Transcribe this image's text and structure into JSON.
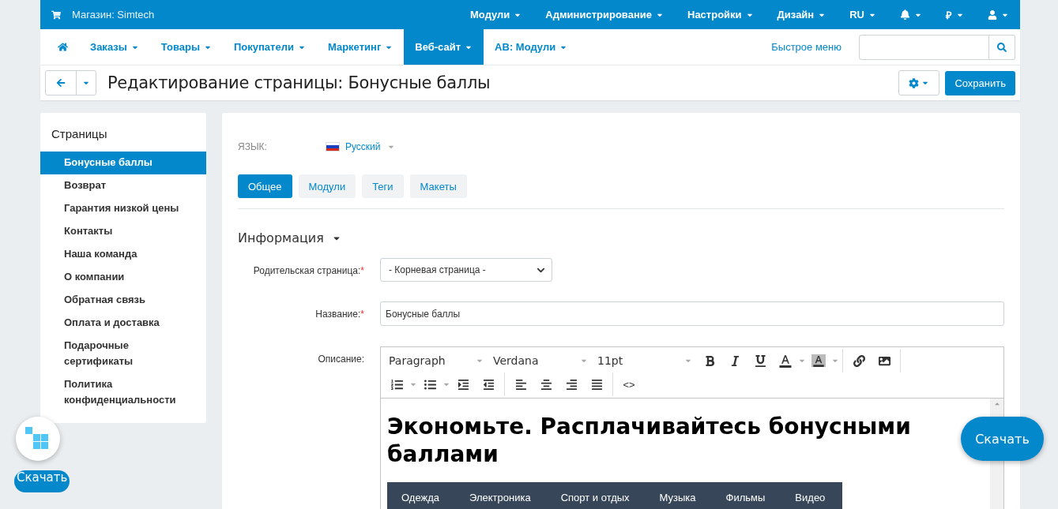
{
  "top_bar": {
    "store": "Магазин: Simtech",
    "menus": [
      "Модули",
      "Администрирование",
      "Настройки",
      "Дизайн",
      "RU"
    ],
    "currency": "₽"
  },
  "nav": {
    "items": [
      {
        "label": "Заказы",
        "selected": false
      },
      {
        "label": "Товары",
        "selected": false
      },
      {
        "label": "Покупатели",
        "selected": false
      },
      {
        "label": "Маркетинг",
        "selected": false
      },
      {
        "label": "Веб-сайт",
        "selected": true
      },
      {
        "label": "AB: Модули",
        "selected": false
      }
    ],
    "quick_menu": "Быстрое меню"
  },
  "title_bar": {
    "title": "Редактирование страницы: Бонусные баллы",
    "save": "Сохранить"
  },
  "sidebar": {
    "title": "Страницы",
    "items": [
      {
        "label": "Бонусные баллы",
        "selected": true
      },
      {
        "label": "Возврат",
        "selected": false
      },
      {
        "label": "Гарантия низкой цены",
        "selected": false
      },
      {
        "label": "Контакты",
        "selected": false
      },
      {
        "label": "Наша команда",
        "selected": false
      },
      {
        "label": "О компании",
        "selected": false
      },
      {
        "label": "Обратная связь",
        "selected": false
      },
      {
        "label": "Оплата и доставка",
        "selected": false
      },
      {
        "label": "Подарочные сертификаты",
        "selected": false
      },
      {
        "label": "Политика конфиденциальности",
        "selected": false
      }
    ]
  },
  "content": {
    "language": {
      "label": "ЯЗЫК:",
      "value": "Русский"
    },
    "tabs": [
      {
        "label": "Общее",
        "selected": true
      },
      {
        "label": "Модули",
        "selected": false
      },
      {
        "label": "Теги",
        "selected": false
      },
      {
        "label": "Макеты",
        "selected": false
      }
    ],
    "section": "Информация",
    "fields": [
      {
        "kind": "select",
        "label": "Родительская страница:",
        "mark": "*",
        "value": "- Корневая страница -"
      },
      {
        "kind": "text",
        "label": "Название:",
        "mark": "*",
        "value": "Бонусные баллы"
      },
      {
        "kind": "editor",
        "label": "Описание:"
      }
    ],
    "editor": {
      "block": "Paragraph",
      "font": "Verdana",
      "size": "11pt",
      "code": "<>",
      "heading": "Экономьте. Расплачивайтесь бонусными баллами",
      "menu": [
        "Одежда",
        "Электроника",
        "Спорт и отдых",
        "Музыка",
        "Фильмы",
        "Видео"
      ]
    }
  },
  "floating": {
    "left_button": "Скачать",
    "right_button": "Скачать"
  }
}
